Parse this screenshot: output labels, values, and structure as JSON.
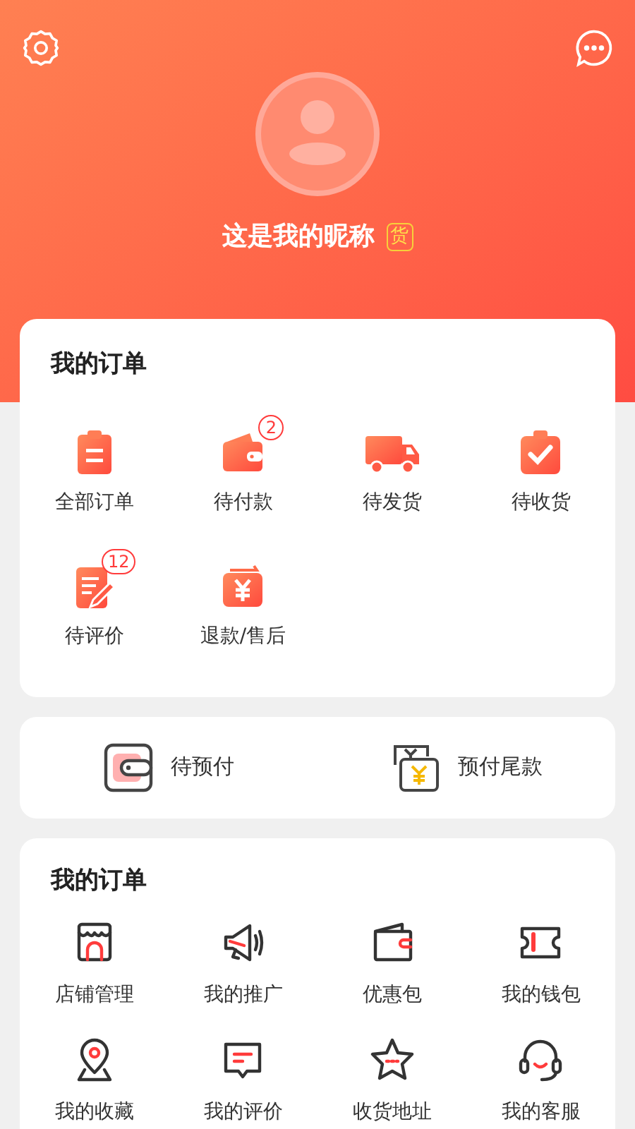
{
  "header": {
    "nickname": "这是我的昵称",
    "badge": "货"
  },
  "orders": {
    "title": "我的订单",
    "items": [
      {
        "kind": "clipboard",
        "label": "全部订单"
      },
      {
        "kind": "wallet",
        "label": "待付款",
        "count": "2"
      },
      {
        "kind": "truck",
        "label": "待发货"
      },
      {
        "kind": "check",
        "label": "待收货"
      },
      {
        "kind": "review",
        "label": "待评价",
        "count": "12"
      },
      {
        "kind": "refund",
        "label": "退款/售后"
      }
    ]
  },
  "prepay": [
    {
      "kind": "wallet",
      "label": "待预付"
    },
    {
      "kind": "yen",
      "label": "预付尾款"
    }
  ],
  "tools": {
    "title": "我的订单",
    "items": [
      {
        "kind": "store",
        "label": "店铺管理"
      },
      {
        "kind": "megaphone",
        "label": "我的推广"
      },
      {
        "kind": "wallet",
        "label": "优惠包"
      },
      {
        "kind": "ticket",
        "label": "我的钱包"
      },
      {
        "kind": "pin",
        "label": "我的收藏"
      },
      {
        "kind": "comment",
        "label": "我的评价"
      },
      {
        "kind": "star",
        "label": "收货地址"
      },
      {
        "kind": "headset",
        "label": "我的客服"
      }
    ]
  }
}
